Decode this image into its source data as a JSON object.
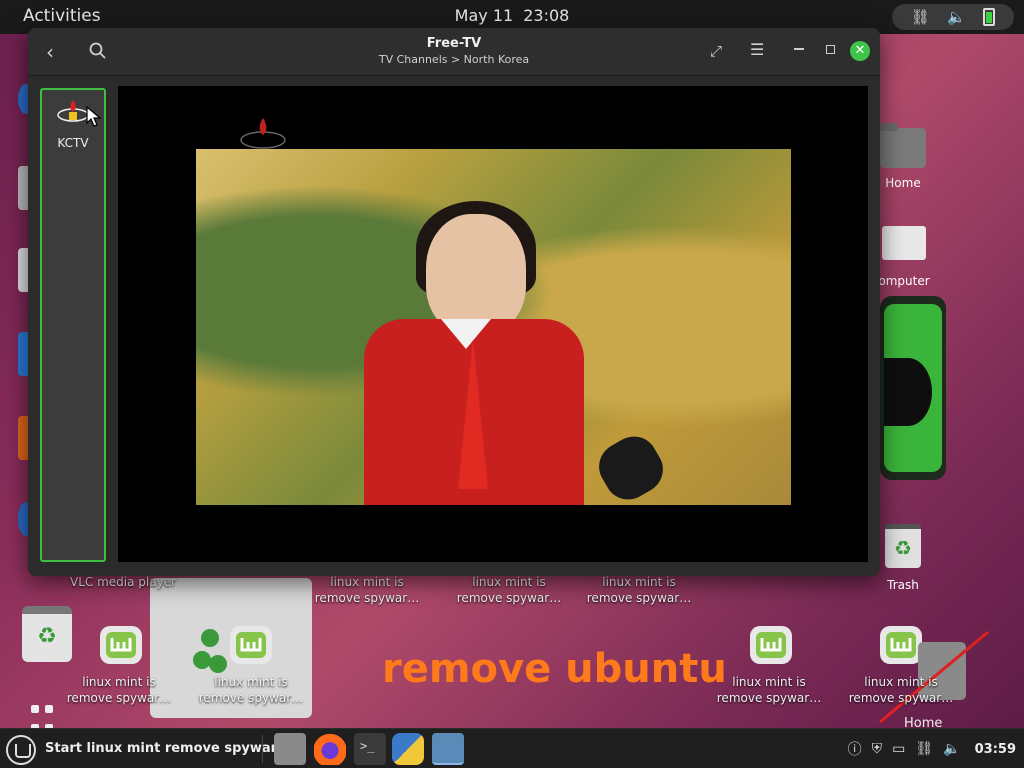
{
  "topbar": {
    "activities": "Activities",
    "date": "May 11",
    "time": "23:08"
  },
  "window": {
    "title": "Free-TV",
    "subtitle": "TV Channels > North Korea"
  },
  "channels": [
    {
      "label": "KCTV"
    }
  ],
  "desktop": {
    "home_label": "Home",
    "computer_label": "omputer",
    "trash_label": "Trash",
    "vlc_label": "VLC media player",
    "mint_items": [
      {
        "line1": "linux mint is",
        "line2": "remove spywar…"
      },
      {
        "line1": "linux mint is",
        "line2": "remove spywar…"
      },
      {
        "line1": "linux mint is",
        "line2": "remove spywar…"
      },
      {
        "line1": "linux mint is",
        "line2": "remove spywar…"
      },
      {
        "line1": "linux mint is",
        "line2": "remove spywar…"
      },
      {
        "line1": "linux mint is",
        "line2": "remove spywar…"
      },
      {
        "line1": "linux mint is",
        "line2": "remove spywar…"
      }
    ],
    "overlay_text": "remove ubuntu",
    "home_bottom": "Home"
  },
  "panel": {
    "start_label": "Start linux mint remove spyware",
    "time": "03:59"
  },
  "colors": {
    "accent_green": "#3fc44a",
    "overlay_orange": "#ff7a1a",
    "wallpaper": "#8a2d5a"
  }
}
